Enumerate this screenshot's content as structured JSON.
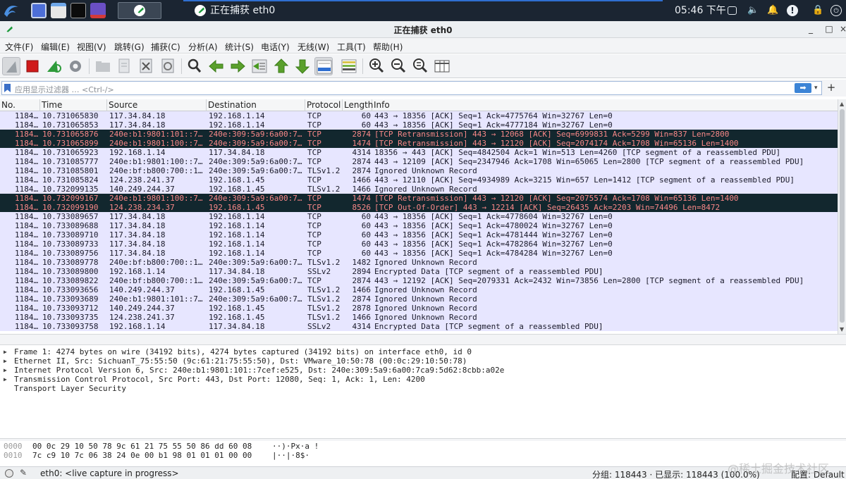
{
  "taskbar": {
    "task_title": "正在捕获 eth0",
    "clock": "05:46 下午"
  },
  "window": {
    "title": "正在捕获 eth0",
    "minimize": "_",
    "maximize": "□",
    "close": "×"
  },
  "menu": [
    "文件(F)",
    "编辑(E)",
    "视图(V)",
    "跳转(G)",
    "捕获(C)",
    "分析(A)",
    "统计(S)",
    "电话(Y)",
    "无线(W)",
    "工具(T)",
    "帮助(H)"
  ],
  "filter": {
    "placeholder": "应用显示过滤器 … <Ctrl-/>",
    "apply_arrow": "➡",
    "dropdown": "▾",
    "add": "+"
  },
  "columns": [
    "No.",
    "Time",
    "Source",
    "Destination",
    "Protocol",
    "Length",
    "Info"
  ],
  "packets": [
    {
      "no": "1184…",
      "time": "10.731065830",
      "src": "117.34.84.18",
      "dst": "192.168.1.14",
      "proto": "TCP",
      "len": "60",
      "info": "443 → 18356 [ACK] Seq=1 Ack=4775764 Win=32767 Len=0",
      "bad": false
    },
    {
      "no": "1184…",
      "time": "10.731065853",
      "src": "117.34.84.18",
      "dst": "192.168.1.14",
      "proto": "TCP",
      "len": "60",
      "info": "443 → 18356 [ACK] Seq=1 Ack=4777184 Win=32767 Len=0",
      "bad": false
    },
    {
      "no": "1184…",
      "time": "10.731065876",
      "src": "240e:b1:9801:101::7…",
      "dst": "240e:309:5a9:6a00:7…",
      "proto": "TCP",
      "len": "2874",
      "info": "[TCP Retransmission] 443 → 12068 [ACK] Seq=6999831 Ack=5299 Win=837 Len=2800",
      "bad": true
    },
    {
      "no": "1184…",
      "time": "10.731065899",
      "src": "240e:b1:9801:100::7…",
      "dst": "240e:309:5a9:6a00:7…",
      "proto": "TCP",
      "len": "1474",
      "info": "[TCP Retransmission] 443 → 12120 [ACK] Seq=2074174 Ack=1708 Win=65136 Len=1400",
      "bad": true
    },
    {
      "no": "1184…",
      "time": "10.731065923",
      "src": "192.168.1.14",
      "dst": "117.34.84.18",
      "proto": "TCP",
      "len": "4314",
      "info": "18356 → 443 [ACK] Seq=4842504 Ack=1 Win=513 Len=4260 [TCP segment of a reassembled PDU]",
      "bad": false
    },
    {
      "no": "1184…",
      "time": "10.731085777",
      "src": "240e:b1:9801:100::7…",
      "dst": "240e:309:5a9:6a00:7…",
      "proto": "TCP",
      "len": "2874",
      "info": "443 → 12109 [ACK] Seq=2347946 Ack=1708 Win=65065 Len=2800 [TCP segment of a reassembled PDU]",
      "bad": false
    },
    {
      "no": "1184…",
      "time": "10.731085801",
      "src": "240e:bf:b800:700::1…",
      "dst": "240e:309:5a9:6a00:7…",
      "proto": "TLSv1.2",
      "len": "2874",
      "info": "Ignored Unknown Record",
      "bad": false
    },
    {
      "no": "1184…",
      "time": "10.731085824",
      "src": "124.238.241.37",
      "dst": "192.168.1.45",
      "proto": "TCP",
      "len": "1466",
      "info": "443 → 12110 [ACK] Seq=4934989 Ack=3215 Win=657 Len=1412 [TCP segment of a reassembled PDU]",
      "bad": false
    },
    {
      "no": "1184…",
      "time": "10.732099135",
      "src": "140.249.244.37",
      "dst": "192.168.1.45",
      "proto": "TLSv1.2",
      "len": "1466",
      "info": "Ignored Unknown Record",
      "bad": false
    },
    {
      "no": "1184…",
      "time": "10.732099167",
      "src": "240e:b1:9801:100::7…",
      "dst": "240e:309:5a9:6a00:7…",
      "proto": "TCP",
      "len": "1474",
      "info": "[TCP Retransmission] 443 → 12120 [ACK] Seq=2075574 Ack=1708 Win=65136 Len=1400",
      "bad": true
    },
    {
      "no": "1184…",
      "time": "10.732099190",
      "src": "124.238.234.37",
      "dst": "192.168.1.45",
      "proto": "TCP",
      "len": "8526",
      "info": "[TCP Out-Of-Order] 443 → 12214 [ACK] Seq=26435 Ack=2203 Win=74496 Len=8472",
      "bad": true
    },
    {
      "no": "1184…",
      "time": "10.733089657",
      "src": "117.34.84.18",
      "dst": "192.168.1.14",
      "proto": "TCP",
      "len": "60",
      "info": "443 → 18356 [ACK] Seq=1 Ack=4778604 Win=32767 Len=0",
      "bad": false
    },
    {
      "no": "1184…",
      "time": "10.733089688",
      "src": "117.34.84.18",
      "dst": "192.168.1.14",
      "proto": "TCP",
      "len": "60",
      "info": "443 → 18356 [ACK] Seq=1 Ack=4780024 Win=32767 Len=0",
      "bad": false
    },
    {
      "no": "1184…",
      "time": "10.733089710",
      "src": "117.34.84.18",
      "dst": "192.168.1.14",
      "proto": "TCP",
      "len": "60",
      "info": "443 → 18356 [ACK] Seq=1 Ack=4781444 Win=32767 Len=0",
      "bad": false
    },
    {
      "no": "1184…",
      "time": "10.733089733",
      "src": "117.34.84.18",
      "dst": "192.168.1.14",
      "proto": "TCP",
      "len": "60",
      "info": "443 → 18356 [ACK] Seq=1 Ack=4782864 Win=32767 Len=0",
      "bad": false
    },
    {
      "no": "1184…",
      "time": "10.733089756",
      "src": "117.34.84.18",
      "dst": "192.168.1.14",
      "proto": "TCP",
      "len": "60",
      "info": "443 → 18356 [ACK] Seq=1 Ack=4784284 Win=32767 Len=0",
      "bad": false
    },
    {
      "no": "1184…",
      "time": "10.733089778",
      "src": "240e:bf:b800:700::1…",
      "dst": "240e:309:5a9:6a00:7…",
      "proto": "TLSv1.2",
      "len": "1482",
      "info": "Ignored Unknown Record",
      "bad": false
    },
    {
      "no": "1184…",
      "time": "10.733089800",
      "src": "192.168.1.14",
      "dst": "117.34.84.18",
      "proto": "SSLv2",
      "len": "2894",
      "info": "Encrypted Data [TCP segment of a reassembled PDU]",
      "bad": false
    },
    {
      "no": "1184…",
      "time": "10.733089822",
      "src": "240e:bf:b800:700::1…",
      "dst": "240e:309:5a9:6a00:7…",
      "proto": "TCP",
      "len": "2874",
      "info": "443 → 12192 [ACK] Seq=2079331 Ack=2432 Win=73856 Len=2800 [TCP segment of a reassembled PDU]",
      "bad": false
    },
    {
      "no": "1184…",
      "time": "10.733093656",
      "src": "140.249.244.37",
      "dst": "192.168.1.45",
      "proto": "TLSv1.2",
      "len": "1466",
      "info": "Ignored Unknown Record",
      "bad": false
    },
    {
      "no": "1184…",
      "time": "10.733093689",
      "src": "240e:b1:9801:101::7…",
      "dst": "240e:309:5a9:6a00:7…",
      "proto": "TLSv1.2",
      "len": "2874",
      "info": "Ignored Unknown Record",
      "bad": false
    },
    {
      "no": "1184…",
      "time": "10.733093712",
      "src": "140.249.244.37",
      "dst": "192.168.1.45",
      "proto": "TLSv1.2",
      "len": "2878",
      "info": "Ignored Unknown Record",
      "bad": false
    },
    {
      "no": "1184…",
      "time": "10.733093735",
      "src": "124.238.241.37",
      "dst": "192.168.1.45",
      "proto": "TLSv1.2",
      "len": "1466",
      "info": "Ignored Unknown Record",
      "bad": false
    },
    {
      "no": "1184…",
      "time": "10.733093758",
      "src": "192.168.1.14",
      "dst": "117.34.84.18",
      "proto": "SSLv2",
      "len": "4314",
      "info": "Encrypted Data [TCP segment of a reassembled PDU]",
      "bad": false
    }
  ],
  "details": [
    {
      "text": "Frame 1: 4274 bytes on wire (34192 bits), 4274 bytes captured (34192 bits) on interface eth0, id 0",
      "expandable": true
    },
    {
      "text": "Ethernet II, Src: SichuanT_75:55:50 (9c:61:21:75:55:50), Dst: VMware_10:50:78 (00:0c:29:10:50:78)",
      "expandable": true
    },
    {
      "text": "Internet Protocol Version 6, Src: 240e:b1:9801:101::7cef:e525, Dst: 240e:309:5a9:6a00:7ca9:5d62:8cbb:a02e",
      "expandable": true
    },
    {
      "text": "Transmission Control Protocol, Src Port: 443, Dst Port: 12080, Seq: 1, Ack: 1, Len: 4200",
      "expandable": true
    },
    {
      "text": "Transport Layer Security",
      "expandable": false
    }
  ],
  "bytes": [
    {
      "offset": "0000",
      "hex": "00 0c 29 10 50 78 9c 61  21 75 55 50 86 dd 60 08",
      "ascii": "··)·Px·a !"
    },
    {
      "offset": "0010",
      "hex": "7c c9 10 7c 06 38 24 0e  00 b1 98 01 01 01 00 00",
      "ascii": "|··|·8$·"
    }
  ],
  "status": {
    "capture": "eth0: <live capture in progress>",
    "stats": "分组: 118443 · 已显示: 118443 (100.0%)",
    "profile": "配置: Default"
  },
  "watermark": "@稀土掘金技术社区",
  "colors": {
    "row_normal_bg": "#e7e6ff",
    "row_bad_bg": "#12272e",
    "row_bad_fg": "#f78787",
    "taskbar_bg": "#1b2532"
  }
}
